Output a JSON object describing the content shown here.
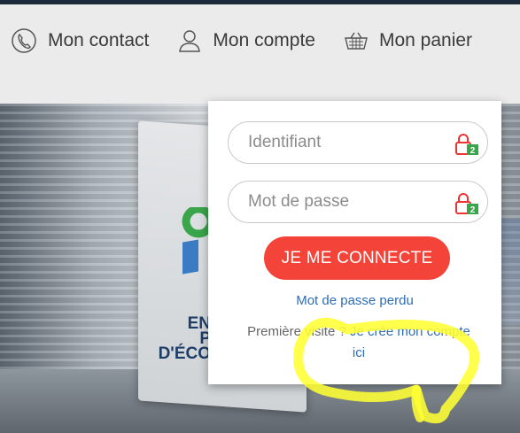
{
  "nav": {
    "items": [
      {
        "label": "Mon contact",
        "icon": "phone-icon"
      },
      {
        "label": "Mon compte",
        "icon": "user-icon"
      },
      {
        "label": "Mon panier",
        "icon": "basket-icon"
      }
    ]
  },
  "hero": {
    "card_lines": [
      "EN",
      "P",
      "D'ÉCO"
    ]
  },
  "login": {
    "identifier_placeholder": "Identifiant",
    "password_placeholder": "Mot de passe",
    "lock_badge": "2",
    "connect_label": "JE ME CONNECTE",
    "forgot_label": "Mot de passe perdu",
    "first_visit_text": "Première visite ?",
    "create_account_label": "Je crée mon compte ici"
  },
  "colors": {
    "accent_red": "#f4443a",
    "link_blue": "#2e6db4",
    "badge_green": "#3aa54a",
    "highlighter_yellow": "#ffff33"
  }
}
